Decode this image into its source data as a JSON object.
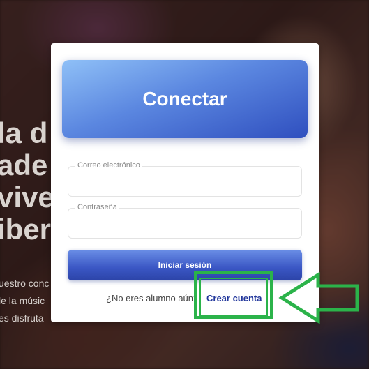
{
  "background": {
    "hero_lines": [
      "la d",
      "ade",
      "vive",
      "iber"
    ],
    "sub_lines": [
      "uestro conc",
      "le la músic",
      "es disfruta"
    ]
  },
  "login_card": {
    "title": "Conectar",
    "email": {
      "label": "Correo electrónico",
      "value": "",
      "placeholder": ""
    },
    "password": {
      "label": "Contraseña",
      "value": "",
      "placeholder": ""
    },
    "submit_label": "Iniciar sesión",
    "signup_prompt": "¿No eres alumno aún?",
    "signup_link": "Crear cuenta"
  },
  "annotation": {
    "highlight_color": "#2bb34a",
    "arrow_icon": "left-arrow-icon"
  },
  "colors": {
    "brand_blue": "#3a56c4",
    "link_blue": "#23389c"
  }
}
